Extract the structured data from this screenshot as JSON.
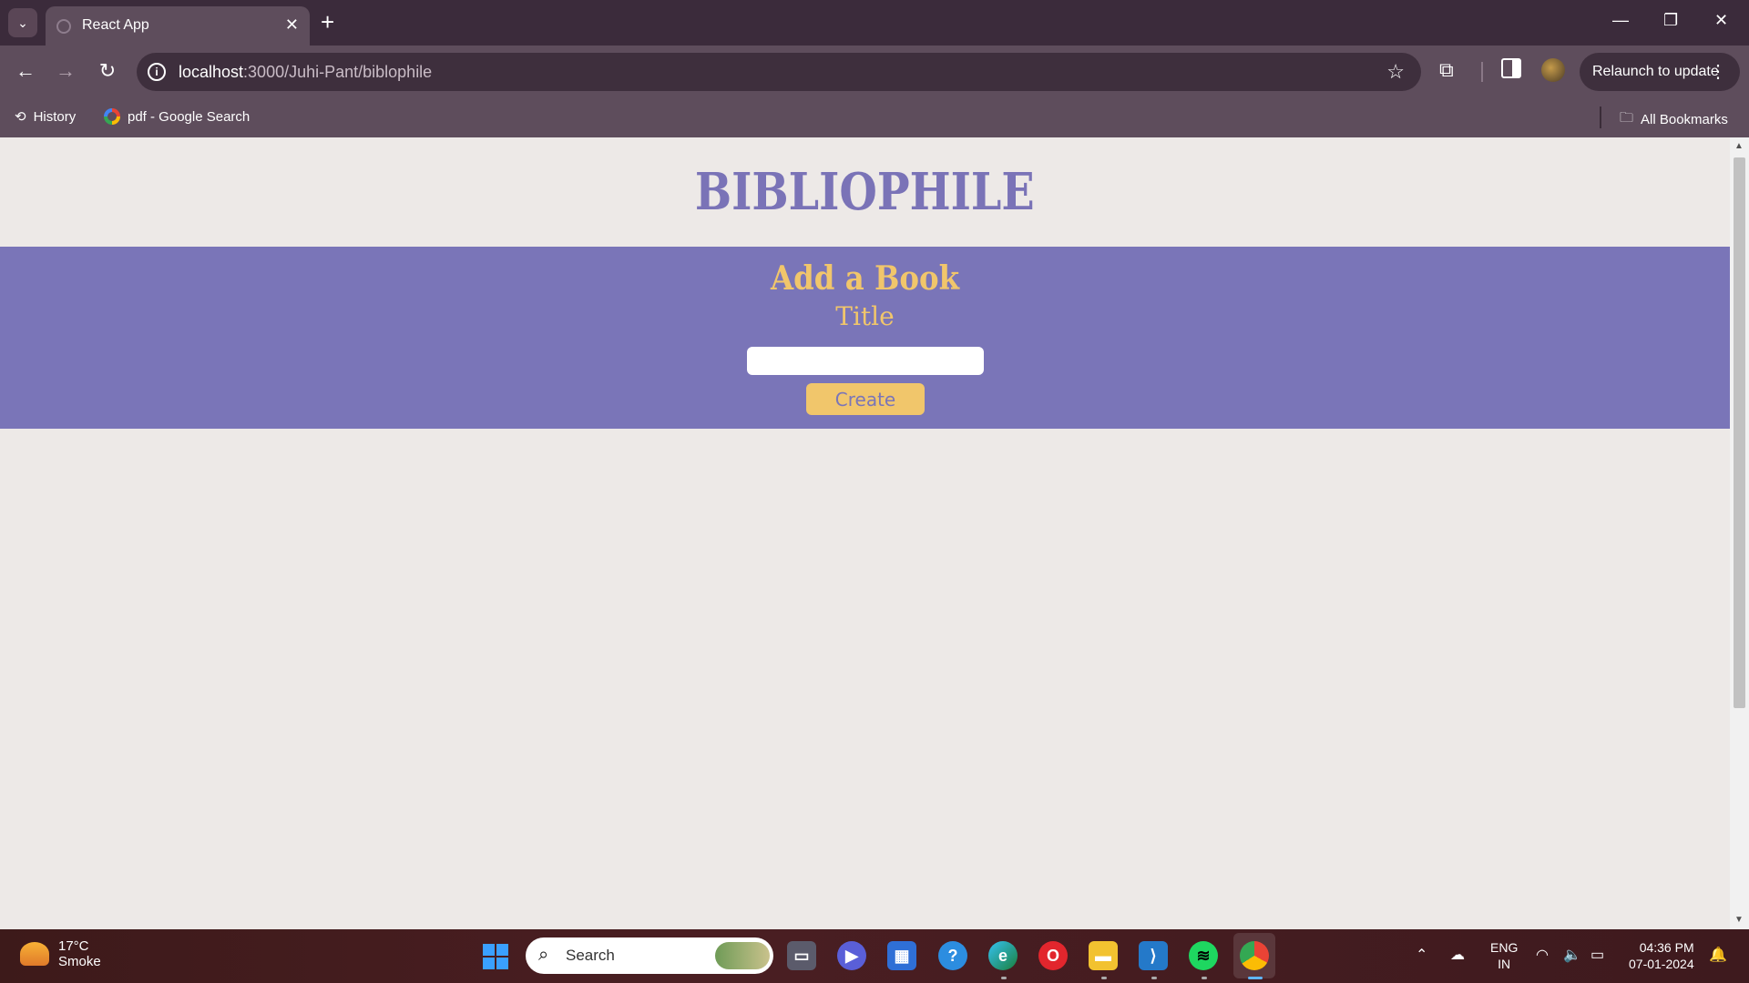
{
  "browser": {
    "tab_title": "React App",
    "url_host": "localhost",
    "url_path": ":3000/Juhi-Pant/biblophile",
    "relaunch_label": "Relaunch to update",
    "bookmarks": [
      {
        "label": "History",
        "icon": "history-icon"
      },
      {
        "label": "pdf - Google Search",
        "icon": "google-icon"
      }
    ],
    "all_bookmarks_label": "All Bookmarks"
  },
  "page": {
    "brand": "BIBLIOPHILE",
    "form": {
      "heading": "Add a Book",
      "title_label": "Title",
      "title_value": "",
      "create_label": "Create"
    },
    "colors": {
      "background": "#ede9e7",
      "brand": "#7a73b7",
      "band": "#7a75b8",
      "accent": "#f1c66b"
    }
  },
  "taskbar": {
    "weather_temp": "17°C",
    "weather_desc": "Smoke",
    "search_placeholder": "Search",
    "lang_line1": "ENG",
    "lang_line2": "IN",
    "time": "04:36 PM",
    "date": "07-01-2024"
  }
}
